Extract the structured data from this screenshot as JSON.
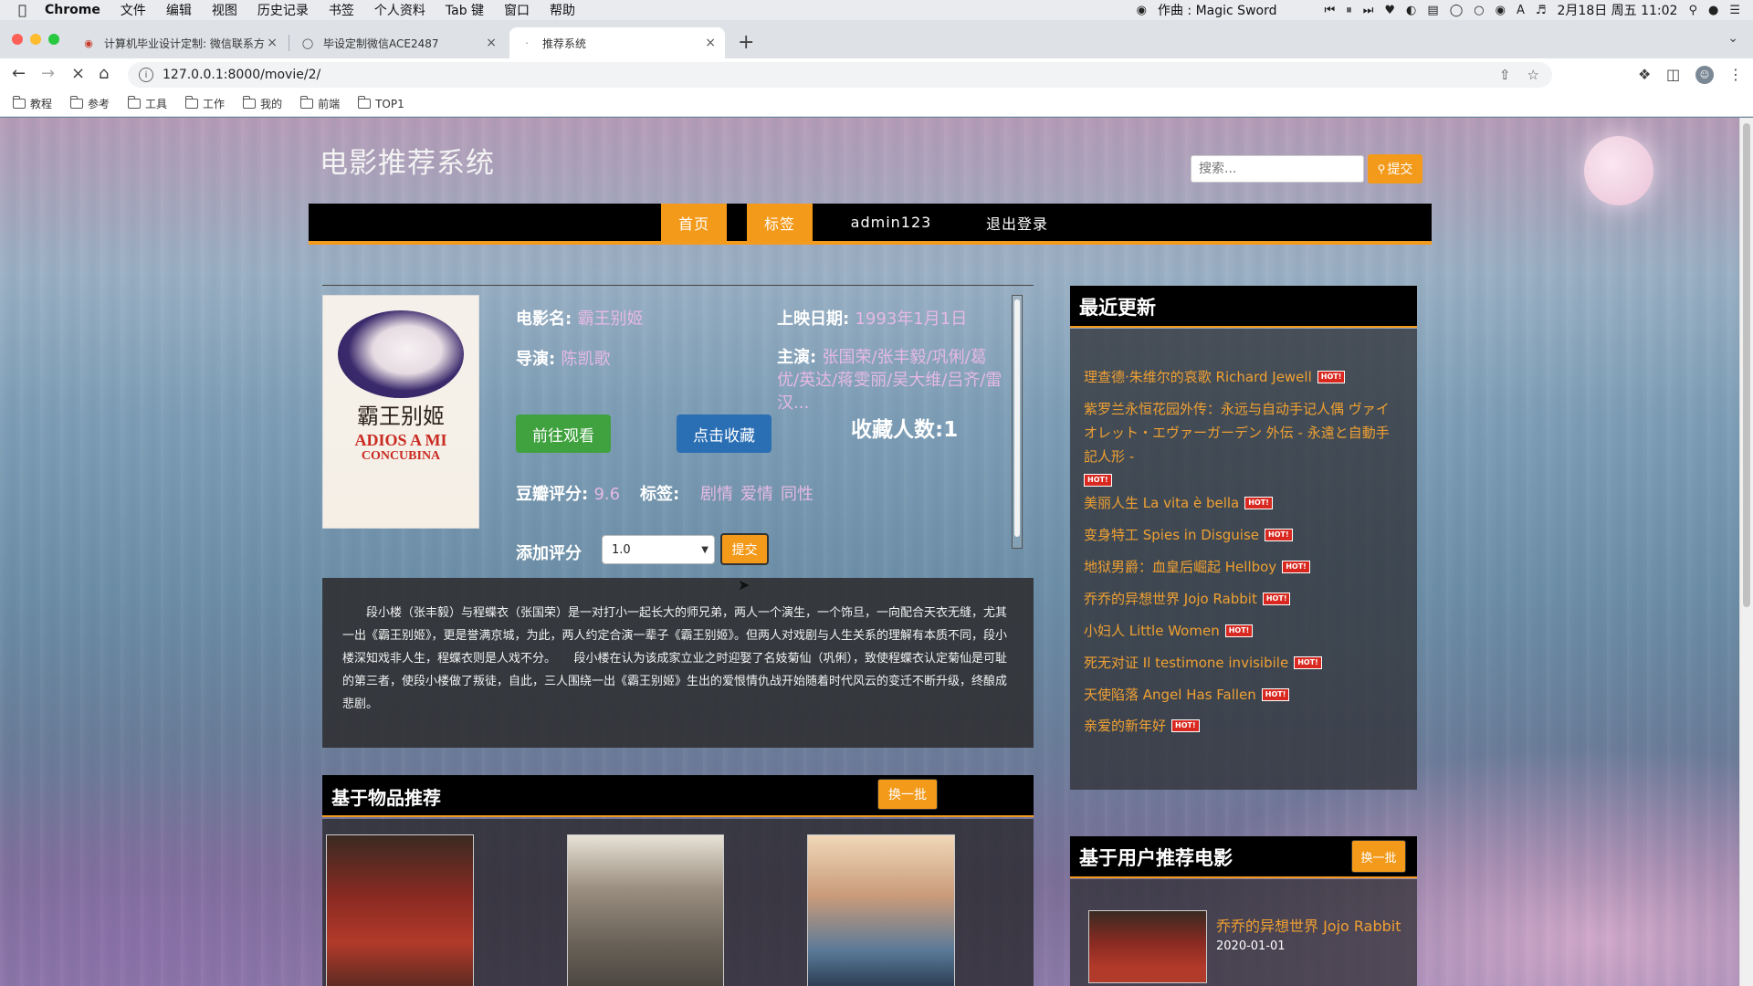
{
  "menubar": {
    "app": "Chrome",
    "items": [
      "文件",
      "编辑",
      "视图",
      "历史记录",
      "书签",
      "个人资料",
      "Tab 键",
      "窗口",
      "帮助"
    ],
    "now_playing": "作曲 : Magic Sword",
    "datetime": "2月18日 周五 11:02"
  },
  "tabs": [
    {
      "title": "计算机毕业设计定制: 微信联系方"
    },
    {
      "title": "毕设定制微信ACE2487"
    },
    {
      "title": "推荐系统"
    }
  ],
  "address": {
    "url": "127.0.0.1:8000/movie/2/"
  },
  "bookmarks": [
    "教程",
    "参考",
    "工具",
    "工作",
    "我的",
    "前端",
    "TOP1"
  ],
  "site": {
    "title": "电影推荐系统",
    "search_placeholder": "搜索...",
    "search_button": "提交",
    "nav": [
      "首页",
      "标签",
      "admin123",
      "退出登录"
    ]
  },
  "movie": {
    "name_label": "电影名:",
    "name": "霸王别姬",
    "director_label": "导演:",
    "director": "陈凯歌",
    "release_label": "上映日期:",
    "release": "1993年1月1日",
    "cast_label": "主演:",
    "cast": "张国荣/张丰毅/巩俐/葛优/英达/蒋雯丽/吴大维/吕齐/雷汉...",
    "watch_button": "前往观看",
    "fav_button": "点击收藏",
    "fav_count": "收藏人数:1",
    "score_label": "豆瓣评分:",
    "score": "9.6",
    "tags_label": "标签:",
    "tags": [
      "剧情",
      "爱情",
      "同性"
    ],
    "rate_label": "添加评分",
    "rate_value": "1.0",
    "rate_submit": "提交",
    "poster": {
      "cn": "霸王别姬",
      "en1": "ADIOS A MI",
      "en2": "CONCUBINA"
    },
    "description": "段小楼（张丰毅）与程蝶衣（张国荣）是一对打小一起长大的师兄弟，两人一个演生，一个饰旦，一向配合天衣无缝，尤其一出《霸王别姬》，更是誉满京城，为此，两人约定合演一辈子《霸王别姬》。但两人对戏剧与人生关系的理解有本质不同，段小楼深知戏非人生，程蝶衣则是人戏不分。　　段小楼在认为该成家立业之时迎娶了名妓菊仙（巩俐），致使程蝶衣认定菊仙是可耻的第三者，使段小楼做了叛徒，自此，三人围绕一出《霸王别姬》生出的爱恨情仇战开始随着时代风云的变迁不断升级，终酿成悲剧。"
  },
  "item_rec": {
    "title": "基于物品推荐",
    "swap": "换一批"
  },
  "latest": {
    "title": "最近更新",
    "hot": "HOT!",
    "items": [
      "理查德·朱维尔的哀歌 Richard Jewell",
      "紫罗兰永恒花园外传：永远与自动手记人偶 ヴァイオレット・エヴァーガーデン 外伝 - 永遠と自動手記人形 -",
      "美丽人生 La vita è bella",
      "变身特工 Spies in Disguise",
      "地狱男爵：血皇后崛起 Hellboy",
      "乔乔的异想世界 Jojo Rabbit",
      "小妇人 Little Women",
      "死无对证 Il testimone invisibile",
      "天使陷落 Angel Has Fallen",
      "亲爱的新年好"
    ]
  },
  "user_rec": {
    "title": "基于用户推荐电影",
    "swap": "换一批",
    "first_title": "乔乔的异想世界 Jojo Rabbit",
    "first_date": "2020-01-01"
  }
}
